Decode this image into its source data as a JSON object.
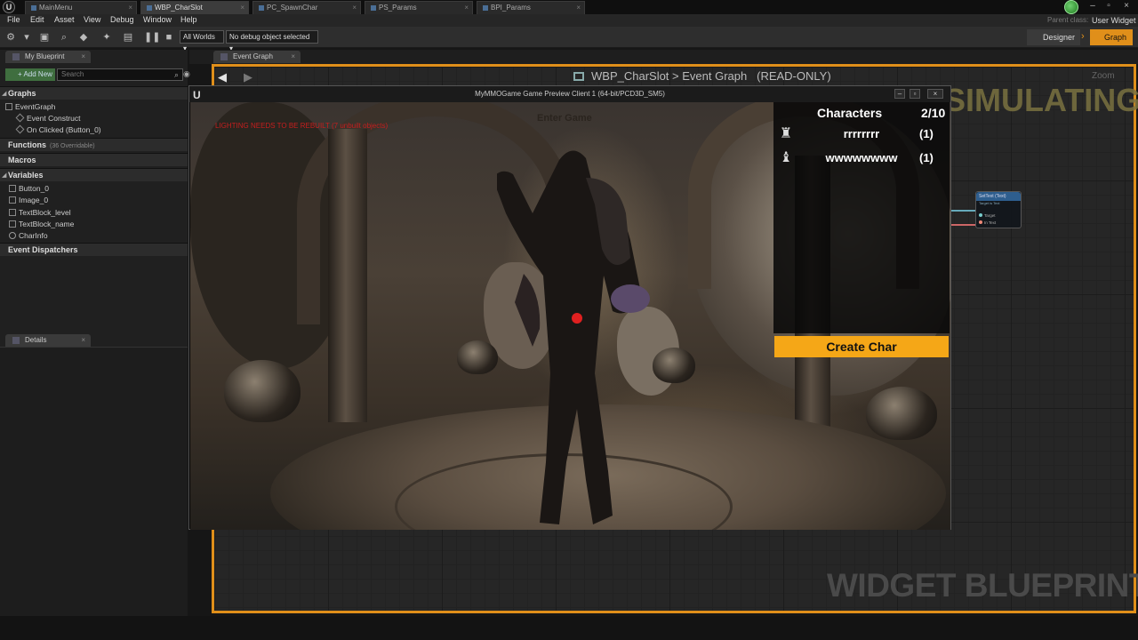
{
  "tabs": [
    {
      "label": "MainMenu"
    },
    {
      "label": "WBP_CharSlot"
    },
    {
      "label": "PC_SpawnChar"
    },
    {
      "label": "PS_Params"
    },
    {
      "label": "BPI_Params"
    }
  ],
  "header": {
    "parent_class_label": "Parent class:",
    "parent_class_value": "User Widget"
  },
  "menu": [
    "File",
    "Edit",
    "Asset",
    "View",
    "Debug",
    "Window",
    "Help"
  ],
  "toolbar": {
    "world_select": "All Worlds",
    "debug_select": "No debug object selected"
  },
  "modes": {
    "designer": "Designer",
    "graph": "Graph"
  },
  "my_blueprint": {
    "tab": "My Blueprint",
    "add_new": "+ Add New",
    "search_placeholder": "Search",
    "graphs_header": "Graphs",
    "event_graph": "EventGraph",
    "event_construct": "Event Construct",
    "on_clicked": "On Clicked (Button_0)",
    "functions_header": "Functions",
    "functions_sub": "(36 Overridable)",
    "macros_header": "Macros",
    "variables_header": "Variables",
    "variables": [
      "Button_0",
      "Image_0",
      "TextBlock_level",
      "TextBlock_name",
      "CharInfo"
    ],
    "dispatchers_header": "Event Dispatchers"
  },
  "details": {
    "tab": "Details"
  },
  "graph": {
    "tab": "Event Graph",
    "breadcrumb_root": "WBP_CharSlot",
    "breadcrumb_sep": ">",
    "breadcrumb_leaf": "Event Graph",
    "readonly": "(READ-ONLY)",
    "zoom": "Zoom",
    "simulating_watermark": "SIMULATING",
    "widget_blueprint_watermark": "WIDGET BLUEPRINT",
    "node": {
      "title": "SetText (Text)",
      "subtitle": "Target is Text",
      "pin_target": "Target",
      "pin_intext": "In Text"
    }
  },
  "game_window": {
    "title": "MyMMOGame Game Preview Client 1 (64-bit/PCD3D_SM5)",
    "lighting_warning": "LIGHTING NEEDS TO BE REBUILT (7 unbuilt objects)",
    "enter_game": "Enter Game"
  },
  "characters_panel": {
    "title": "Characters",
    "count": "2/10",
    "rows": [
      {
        "name": "rrrrrrrr",
        "level": "(1)",
        "icon": "warrior-icon"
      },
      {
        "name": "wwwwwwww",
        "level": "(1)",
        "icon": "hooded-icon"
      }
    ],
    "create_button": "Create Char"
  },
  "colors": {
    "accent_orange": "#e08f1a",
    "create_button": "#f5a717",
    "warning_red": "#c61e1e"
  }
}
